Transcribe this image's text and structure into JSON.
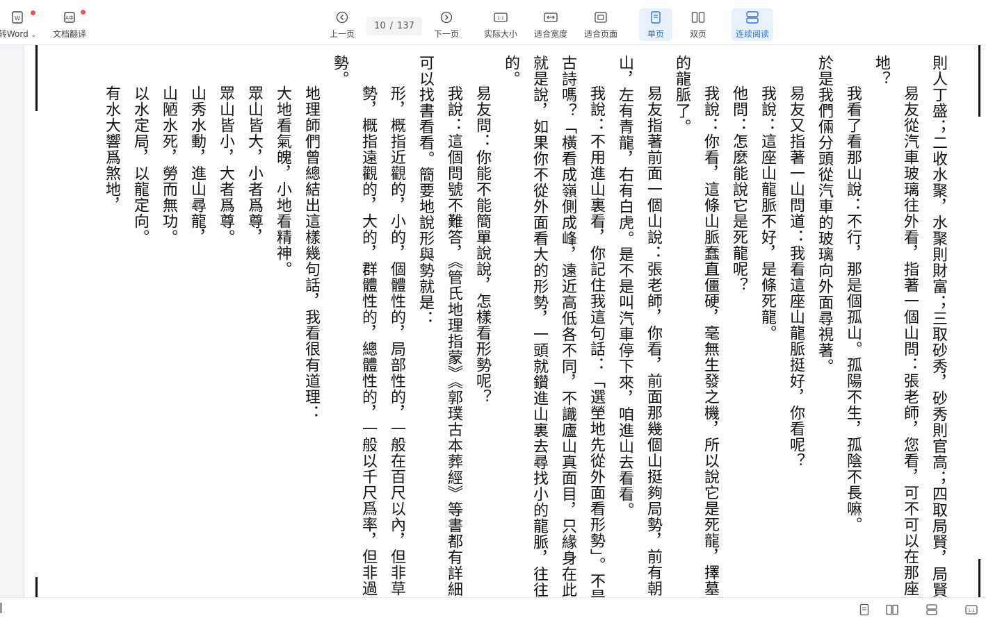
{
  "toolbar": {
    "to_word": {
      "label": "转Word",
      "icon": "word-doc-icon"
    },
    "translate": {
      "label": "文档翻译",
      "icon": "translate-doc-icon"
    },
    "prev_page": {
      "label": "上一页",
      "icon": "chevron-left-circle-icon"
    },
    "page_indicator": {
      "current": "10",
      "separator": "/",
      "total": "137"
    },
    "next_page": {
      "label": "下一页",
      "icon": "chevron-right-circle-icon"
    },
    "actual_size": {
      "label": "实际大小",
      "icon": "actual-size-icon"
    },
    "fit_width": {
      "label": "适合宽度",
      "icon": "fit-width-icon"
    },
    "fit_page": {
      "label": "适合页面",
      "icon": "fit-page-icon"
    },
    "single_page": {
      "label": "单页",
      "icon": "single-page-icon",
      "active": true
    },
    "double_page": {
      "label": "双页",
      "icon": "double-page-icon"
    },
    "continuous": {
      "label": "连续阅读",
      "icon": "continuous-read-icon",
      "active": true
    }
  },
  "colors": {
    "accent": "#2f6fe0",
    "active_bg": "#e9f1fd",
    "red_dot": "#f04e5e"
  },
  "document": {
    "columns": [
      "則人丁盛；二收水聚，水聚則財富；三取砂秀，砂秀則官高；四取局賢，局賢則",
      "易友從汽車玻璃往外看，指著一個山問：張老師，您看，可不可以在那座山",
      "地？",
      "我看了看那山說：不行，那是個孤山。孤陽不生，孤陰不長嘛。",
      "於是我們倆分頭從汽車的玻璃向外面尋視著。",
      "易友又指著一山問道：我看這座山龍脈挺好，你看呢？",
      "我說：這座山龍脈不好，是條死龍。",
      "他問：怎麼能說它是死龍呢？",
      "我說：你看，這條山脈蠢直僵硬，毫無生發之機，所以說它是死龍，擇墓最忌",
      "的龍脈了。",
      "易友指著前面一個山說：張老師，你看，前面那幾個山挺夠局勢，前有朝山",
      "山，左有青龍，右有白虎。是不是叫汽車停下來，咱進山去看看。",
      "我說：不用進山裏看，你記住我這句話：「選塋地先從外面看形勢」。不是先",
      "古詩嗎？「橫看成嶺側成峰，遠近高低各不同，不識廬山真面目，只緣身在此山中",
      "就是說，如果你不從外面看大的形勢，一頭就鑽進山裏去尋找小的龍脈，往往會",
      "的。",
      "易友問：你能不能簡單說說，怎樣看形勢呢？",
      "我說：這個問號不難答，《管氏地理指蒙》《郭璞古本葬經》等書都有詳細論",
      "可以找書看看。簡要地說形與勢就是：",
      "形，概指近觀的，小的，個體性的，局部性的，一般在百尺以內，但非草芥之形",
      "勢，概指遠觀的，大的，群體性的，總體性的，一般以千尺爲率，但非過遠",
      "勢。",
      "地理師們曾總結出這樣幾句話，我看很有道理：",
      "大地看氣魄，小地看精神。",
      "眾山皆大，小者爲尊，",
      "眾山皆小，大者爲尊。",
      "山秀水動，進山尋龍，",
      "山陋水死，勞而無功。",
      "以水定局，以龍定向。",
      "有水大響爲煞地，"
    ]
  },
  "statusbar": {
    "icons": [
      "single-page-icon",
      "double-page-icon",
      "continuous-read-icon",
      "actual-size-icon"
    ]
  }
}
